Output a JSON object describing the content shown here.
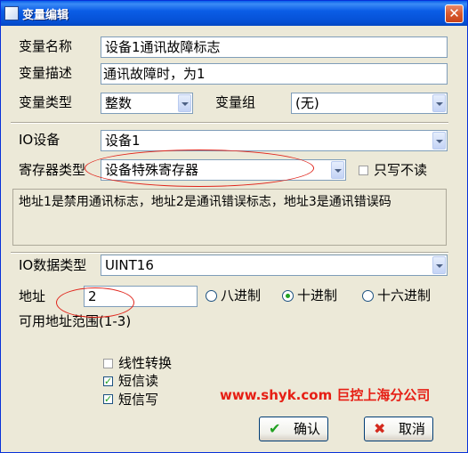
{
  "window": {
    "title": "变量编辑",
    "close_symbol": "✕"
  },
  "form": {
    "name_label": "变量名称",
    "name_value": "设备1通讯故障标志",
    "desc_label": "变量描述",
    "desc_value": "通讯故障时，为1",
    "type_label": "变量类型",
    "type_value": "整数",
    "group_label": "变量组",
    "group_value": "(无)",
    "io_device_label": "IO设备",
    "io_device_value": "设备1",
    "register_type_label": "寄存器类型",
    "register_type_value": "设备特殊寄存器",
    "write_only_label": "只写不读",
    "info_text": "地址1是禁用通讯标志，地址2是通讯错误标志，地址3是通讯错误码",
    "io_data_type_label": "IO数据类型",
    "io_data_type_value": "UINT16",
    "address_label": "地址",
    "address_value": "2",
    "radio_octal": "八进制",
    "radio_decimal": "十进制",
    "radio_hex": "十六进制",
    "address_range": "可用地址范围(1-3)",
    "linear_label": "线性转换",
    "sms_read_label": "短信读",
    "sms_write_label": "短信写"
  },
  "checkbox_states": {
    "write_only": false,
    "linear": false,
    "sms_read": true,
    "sms_write": true
  },
  "radio_selected": "decimal",
  "watermark": "www.shyk.com 巨控上海分公司",
  "buttons": {
    "ok_label": "确认",
    "ok_icon": "✔",
    "cancel_label": "取消",
    "cancel_icon": "✖"
  },
  "colors": {
    "title_bar": "#0A5FEA",
    "dialog_bg": "#ECE9D8",
    "annotation_red": "#E0241B",
    "check_green": "#21A121"
  }
}
